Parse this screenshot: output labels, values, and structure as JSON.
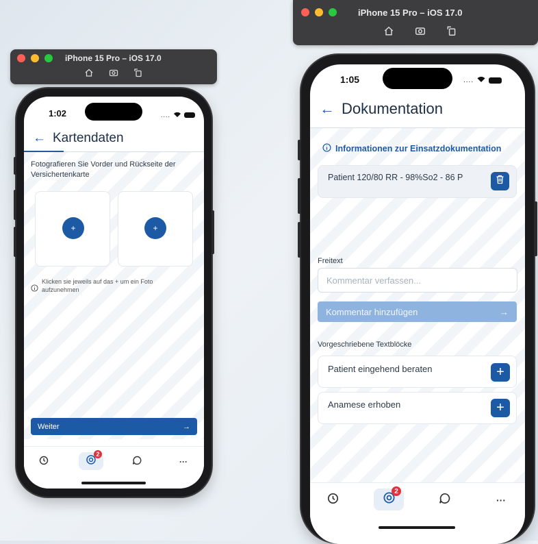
{
  "colors": {
    "brand": "#1d5aa6",
    "badge": "#e0323c",
    "light_red": "#fe5f57",
    "light_yellow": "#febc2e",
    "light_green": "#28c840"
  },
  "left": {
    "simulator": {
      "title": "iPhone 15 Pro – iOS 17.0",
      "icons": [
        "home-icon",
        "screenshot-icon",
        "rotate-icon"
      ]
    },
    "status": {
      "time": "1:02"
    },
    "nav": {
      "title": "Kartendaten"
    },
    "instruction": "Fotografieren Sie Vorder und Rückseite der Versichertenkarte",
    "photo_slots": [
      {
        "plus": "+"
      },
      {
        "plus": "+"
      }
    ],
    "hint": "Klicken sie jeweils auf das + um ein Foto aufzunehmen",
    "button": {
      "label": "Weiter",
      "arrow": "→"
    },
    "tabs": [
      {
        "icon": "clock-icon"
      },
      {
        "icon": "lifebuoy-icon",
        "badge": "2"
      },
      {
        "icon": "chat-bubble-icon"
      },
      {
        "icon": "more-icon",
        "glyph": "···"
      }
    ]
  },
  "right": {
    "simulator": {
      "title": "iPhone 15 Pro – iOS 17.0",
      "icons": [
        "home-icon",
        "screenshot-icon",
        "rotate-icon"
      ]
    },
    "status": {
      "time": "1:05"
    },
    "nav": {
      "title": "Dokumentation"
    },
    "info_link": "Informationen zur Einsatzdokumentation",
    "entry": {
      "text": "Patient 120/80 RR - 98%So2 - 86 P"
    },
    "freitext": {
      "label": "Freitext",
      "placeholder": "Kommentar verfassen...",
      "button_label": "Kommentar hinzufügen",
      "button_arrow": "→"
    },
    "textblocks": {
      "label": "Vorgeschriebene Textblöcke",
      "items": [
        {
          "text": "Patient eingehend beraten"
        },
        {
          "text": "Anamese erhoben"
        }
      ]
    },
    "tabs": [
      {
        "icon": "clock-icon"
      },
      {
        "icon": "lifebuoy-icon",
        "badge": "2"
      },
      {
        "icon": "chat-bubble-icon"
      },
      {
        "icon": "more-icon",
        "glyph": "···"
      }
    ]
  }
}
